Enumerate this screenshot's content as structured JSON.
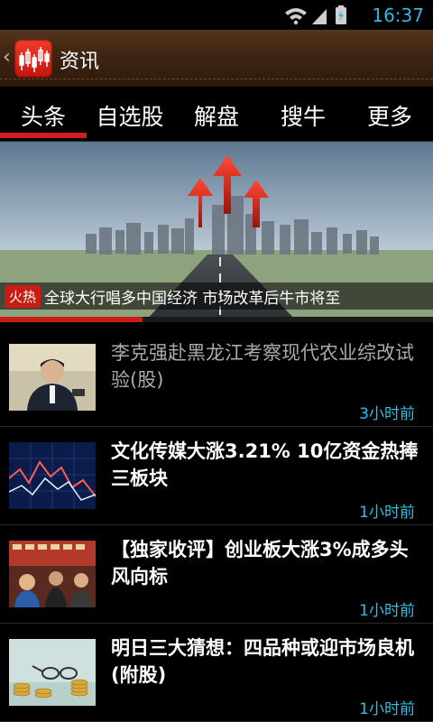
{
  "status_bar": {
    "time": "16:37"
  },
  "app_bar": {
    "title": "资讯"
  },
  "tabs": [
    {
      "label": "头条",
      "active": true
    },
    {
      "label": "自选股"
    },
    {
      "label": "解盘"
    },
    {
      "label": "搜牛"
    },
    {
      "label": "更多"
    }
  ],
  "banner": {
    "tag": "火热",
    "text": "全球大行唱多中国经济  市场改革后牛市将至",
    "progress": 0.33
  },
  "news": [
    {
      "title": "李克强赴黑龙江考察现代农业综改试验(股)",
      "time": "3小时前",
      "read": true
    },
    {
      "title": "文化传媒大涨3.21% 10亿资金热捧三板块",
      "time": "1小时前",
      "read": false
    },
    {
      "title": "【独家收评】创业板大涨3%成多头风向标",
      "time": "1小时前",
      "read": false
    },
    {
      "title": "明日三大猜想：四品种或迎市场良机(附股)",
      "time": "1小时前",
      "read": false
    }
  ],
  "colors": {
    "accent": "#d51d1d",
    "time_text": "#2cc0e8",
    "status_blue": "#33b5e5"
  }
}
